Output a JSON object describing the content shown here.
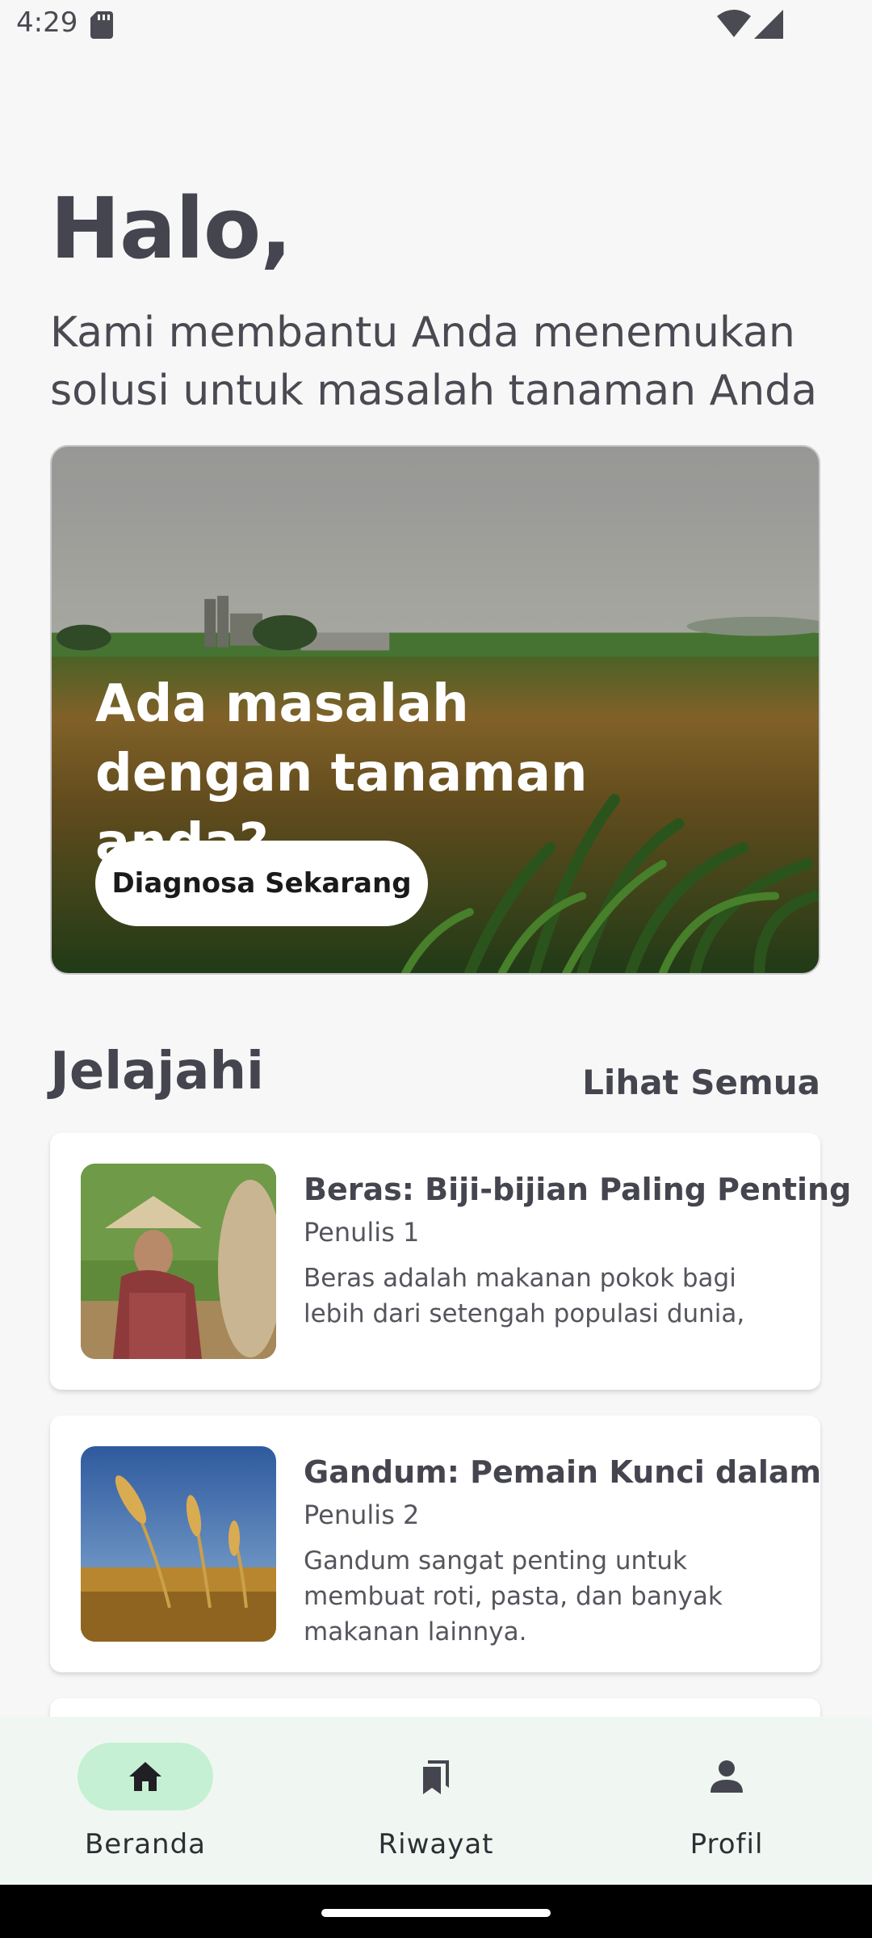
{
  "status_bar": {
    "time": "4:29"
  },
  "greeting": "Halo,",
  "subtitle": "Kami membantu Anda menemukan solusi untuk masalah tanaman Anda",
  "hero": {
    "title": "Ada masalah dengan tanaman anda?",
    "button_label": "Diagnosa Sekarang"
  },
  "explore": {
    "title": "Jelajahi",
    "see_all": "Lihat Semua",
    "articles": [
      {
        "title": "Beras: Biji-bijian Paling Penting",
        "author": "Penulis 1",
        "excerpt": "Beras adalah makanan pokok bagi lebih dari setengah populasi dunia,"
      },
      {
        "title": "Gandum: Pemain Kunci dalam",
        "author": "Penulis 2",
        "excerpt": "Gandum sangat penting untuk membuat roti, pasta, dan banyak makanan lainnya."
      }
    ]
  },
  "bottom_nav": {
    "items": [
      {
        "label": "Beranda",
        "icon": "home-icon",
        "active": true
      },
      {
        "label": "Riwayat",
        "icon": "bookmarks-icon",
        "active": false
      },
      {
        "label": "Profil",
        "icon": "person-icon",
        "active": false
      }
    ]
  },
  "colors": {
    "background": "#f7f7f8",
    "text": "#45454f",
    "nav_background": "#f0f7f2",
    "nav_active_pill": "#c6f0d3"
  }
}
